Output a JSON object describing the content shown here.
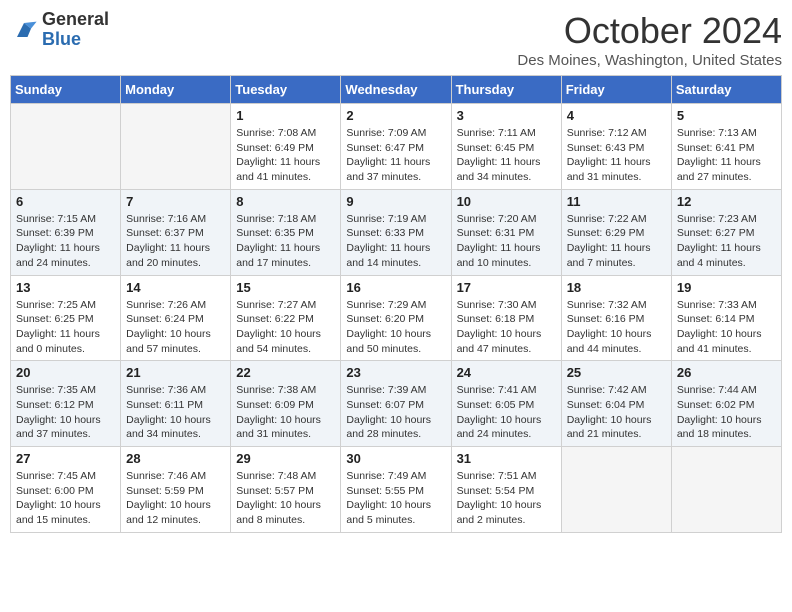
{
  "header": {
    "logo_general": "General",
    "logo_blue": "Blue",
    "month": "October 2024",
    "location": "Des Moines, Washington, United States"
  },
  "days_of_week": [
    "Sunday",
    "Monday",
    "Tuesday",
    "Wednesday",
    "Thursday",
    "Friday",
    "Saturday"
  ],
  "weeks": [
    [
      {
        "day": "",
        "info": ""
      },
      {
        "day": "",
        "info": ""
      },
      {
        "day": "1",
        "info": "Sunrise: 7:08 AM\nSunset: 6:49 PM\nDaylight: 11 hours and 41 minutes."
      },
      {
        "day": "2",
        "info": "Sunrise: 7:09 AM\nSunset: 6:47 PM\nDaylight: 11 hours and 37 minutes."
      },
      {
        "day": "3",
        "info": "Sunrise: 7:11 AM\nSunset: 6:45 PM\nDaylight: 11 hours and 34 minutes."
      },
      {
        "day": "4",
        "info": "Sunrise: 7:12 AM\nSunset: 6:43 PM\nDaylight: 11 hours and 31 minutes."
      },
      {
        "day": "5",
        "info": "Sunrise: 7:13 AM\nSunset: 6:41 PM\nDaylight: 11 hours and 27 minutes."
      }
    ],
    [
      {
        "day": "6",
        "info": "Sunrise: 7:15 AM\nSunset: 6:39 PM\nDaylight: 11 hours and 24 minutes."
      },
      {
        "day": "7",
        "info": "Sunrise: 7:16 AM\nSunset: 6:37 PM\nDaylight: 11 hours and 20 minutes."
      },
      {
        "day": "8",
        "info": "Sunrise: 7:18 AM\nSunset: 6:35 PM\nDaylight: 11 hours and 17 minutes."
      },
      {
        "day": "9",
        "info": "Sunrise: 7:19 AM\nSunset: 6:33 PM\nDaylight: 11 hours and 14 minutes."
      },
      {
        "day": "10",
        "info": "Sunrise: 7:20 AM\nSunset: 6:31 PM\nDaylight: 11 hours and 10 minutes."
      },
      {
        "day": "11",
        "info": "Sunrise: 7:22 AM\nSunset: 6:29 PM\nDaylight: 11 hours and 7 minutes."
      },
      {
        "day": "12",
        "info": "Sunrise: 7:23 AM\nSunset: 6:27 PM\nDaylight: 11 hours and 4 minutes."
      }
    ],
    [
      {
        "day": "13",
        "info": "Sunrise: 7:25 AM\nSunset: 6:25 PM\nDaylight: 11 hours and 0 minutes."
      },
      {
        "day": "14",
        "info": "Sunrise: 7:26 AM\nSunset: 6:24 PM\nDaylight: 10 hours and 57 minutes."
      },
      {
        "day": "15",
        "info": "Sunrise: 7:27 AM\nSunset: 6:22 PM\nDaylight: 10 hours and 54 minutes."
      },
      {
        "day": "16",
        "info": "Sunrise: 7:29 AM\nSunset: 6:20 PM\nDaylight: 10 hours and 50 minutes."
      },
      {
        "day": "17",
        "info": "Sunrise: 7:30 AM\nSunset: 6:18 PM\nDaylight: 10 hours and 47 minutes."
      },
      {
        "day": "18",
        "info": "Sunrise: 7:32 AM\nSunset: 6:16 PM\nDaylight: 10 hours and 44 minutes."
      },
      {
        "day": "19",
        "info": "Sunrise: 7:33 AM\nSunset: 6:14 PM\nDaylight: 10 hours and 41 minutes."
      }
    ],
    [
      {
        "day": "20",
        "info": "Sunrise: 7:35 AM\nSunset: 6:12 PM\nDaylight: 10 hours and 37 minutes."
      },
      {
        "day": "21",
        "info": "Sunrise: 7:36 AM\nSunset: 6:11 PM\nDaylight: 10 hours and 34 minutes."
      },
      {
        "day": "22",
        "info": "Sunrise: 7:38 AM\nSunset: 6:09 PM\nDaylight: 10 hours and 31 minutes."
      },
      {
        "day": "23",
        "info": "Sunrise: 7:39 AM\nSunset: 6:07 PM\nDaylight: 10 hours and 28 minutes."
      },
      {
        "day": "24",
        "info": "Sunrise: 7:41 AM\nSunset: 6:05 PM\nDaylight: 10 hours and 24 minutes."
      },
      {
        "day": "25",
        "info": "Sunrise: 7:42 AM\nSunset: 6:04 PM\nDaylight: 10 hours and 21 minutes."
      },
      {
        "day": "26",
        "info": "Sunrise: 7:44 AM\nSunset: 6:02 PM\nDaylight: 10 hours and 18 minutes."
      }
    ],
    [
      {
        "day": "27",
        "info": "Sunrise: 7:45 AM\nSunset: 6:00 PM\nDaylight: 10 hours and 15 minutes."
      },
      {
        "day": "28",
        "info": "Sunrise: 7:46 AM\nSunset: 5:59 PM\nDaylight: 10 hours and 12 minutes."
      },
      {
        "day": "29",
        "info": "Sunrise: 7:48 AM\nSunset: 5:57 PM\nDaylight: 10 hours and 8 minutes."
      },
      {
        "day": "30",
        "info": "Sunrise: 7:49 AM\nSunset: 5:55 PM\nDaylight: 10 hours and 5 minutes."
      },
      {
        "day": "31",
        "info": "Sunrise: 7:51 AM\nSunset: 5:54 PM\nDaylight: 10 hours and 2 minutes."
      },
      {
        "day": "",
        "info": ""
      },
      {
        "day": "",
        "info": ""
      }
    ]
  ]
}
